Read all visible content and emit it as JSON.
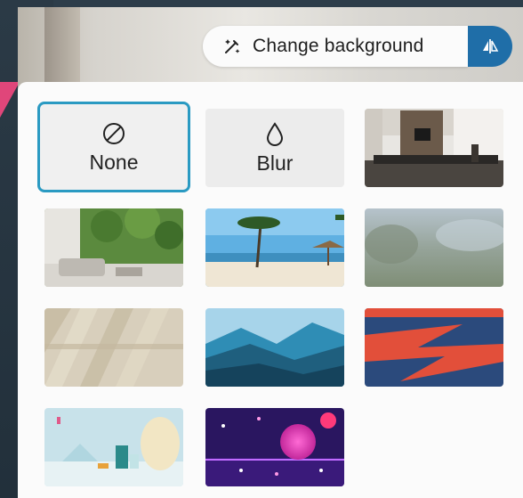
{
  "header": {
    "change_background_label": "Change background",
    "wand_icon": "magic-wand-icon",
    "effects_icon": "effects-icon"
  },
  "options": {
    "none_label": "None",
    "blur_label": "Blur"
  },
  "backgrounds": [
    {
      "name": "office"
    },
    {
      "name": "living-room-forest"
    },
    {
      "name": "beach"
    },
    {
      "name": "blurred-landscape"
    },
    {
      "name": "sunlight-shadows"
    },
    {
      "name": "blue-mountains"
    },
    {
      "name": "abstract-red-blue"
    },
    {
      "name": "pastel-3d-scene"
    },
    {
      "name": "neon-spheres"
    }
  ],
  "colors": {
    "accent": "#1f6ea8",
    "selected_outline": "#2a9ac2"
  }
}
